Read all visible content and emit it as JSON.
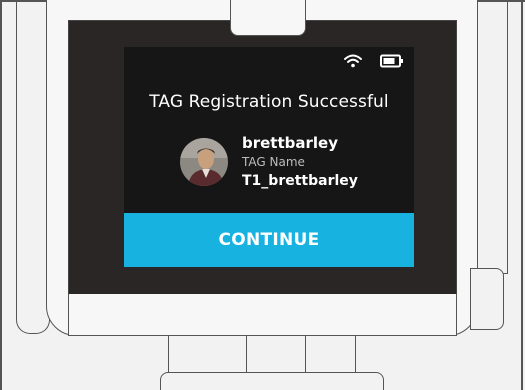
{
  "status_bar": {
    "wifi_icon": "wifi-icon",
    "battery_icon": "battery-icon"
  },
  "dialog": {
    "title": "TAG Registration Successful",
    "username": "brettbarley",
    "tag_label": "TAG Name",
    "tag_value": "T1_brettbarley",
    "continue_label": "CONTINUE"
  },
  "colors": {
    "screen_bg": "#161616",
    "accent": "#18b2e0",
    "bezel": "#2a2626",
    "text_primary": "#ffffff",
    "text_secondary": "#bdbdbd"
  }
}
